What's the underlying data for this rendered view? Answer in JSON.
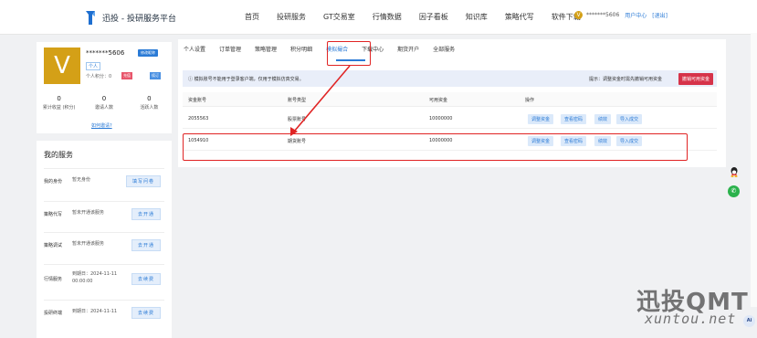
{
  "brand": {
    "title": "迅投 - 投研服务平台"
  },
  "nav": [
    "首页",
    "投研服务",
    "GT交易室",
    "行情数据",
    "因子看板",
    "知识库",
    "策略代写",
    "软件下载"
  ],
  "user_top": {
    "badge": "V",
    "account": "*******5606",
    "center": "用户中心",
    "logout": "[退出]"
  },
  "profile": {
    "avatar_letter": "V",
    "account": "*******5606",
    "edit_label": "修改昵称",
    "role_tag": "个人",
    "points_label": "个人积分：0",
    "tag_red": "充值",
    "tag_blue": "续订",
    "stats": [
      {
        "value": "0",
        "label": "累计收益 (积分)"
      },
      {
        "value": "0",
        "label": "邀请人数"
      },
      {
        "value": "0",
        "label": "活跃人数"
      }
    ],
    "invite_link": "如何邀请?"
  },
  "services": {
    "title": "我的服务",
    "rows": [
      {
        "key": "我的身份",
        "value": "暂无身份",
        "button": "填写问卷"
      },
      {
        "key": "策略代写",
        "value": "暂未开通该服务",
        "button": "去开通"
      },
      {
        "key": "策略调试",
        "value": "暂未开通该服务",
        "button": "去开通"
      },
      {
        "key": "行情服务",
        "value": "到期日：2024-11-11 00:00:00",
        "button": "去续费"
      },
      {
        "key": "投研终端",
        "value": "到期日：2024-11-11",
        "button": "去续费"
      }
    ]
  },
  "tabs": [
    "个人设置",
    "订单管理",
    "策略管理",
    "积分明细",
    "模拟撮合",
    "下载中心",
    "期货开户",
    "全部服务"
  ],
  "active_tab": "模拟撮合",
  "notice": {
    "text": "ⓘ 模拟账号不能用于登录客户端，仅用于模拟仿真交易。",
    "tip": "提示：调整资金时需先撤销可用资金",
    "button": "撤销可用资金"
  },
  "table": {
    "headers": [
      "资金账号",
      "账号类型",
      "可用资金",
      "操作"
    ],
    "rows": [
      {
        "account": "2055563",
        "type": "股票账号",
        "funds": "10000000",
        "actions": [
          "调整资金",
          "查看密码",
          "绩效",
          "导入成交"
        ]
      },
      {
        "account": "1054910",
        "type": "期货账号",
        "funds": "10000000",
        "actions": [
          "调整资金",
          "查看密码",
          "绩效",
          "导入成交"
        ]
      }
    ]
  },
  "floating": {
    "ai_label": "Ai"
  },
  "watermark": {
    "big": "迅投QMT",
    "small": "xuntou.net"
  }
}
